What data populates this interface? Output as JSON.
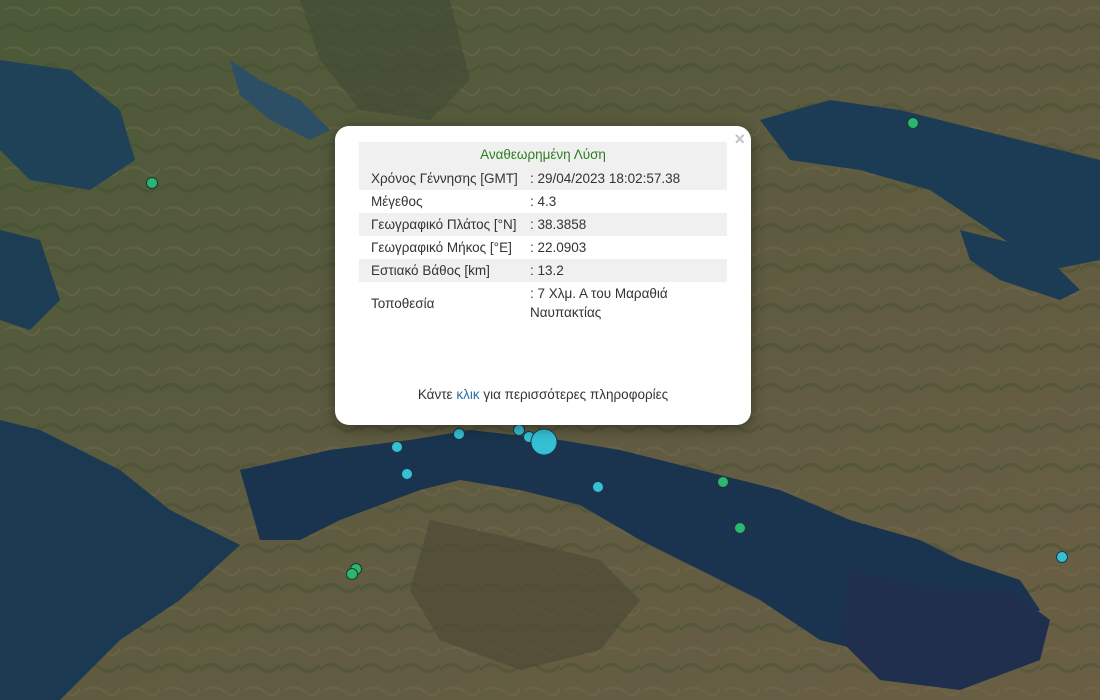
{
  "popup": {
    "header": "Αναθεωρημένη Λύση",
    "close_label": "×",
    "rows": [
      {
        "label": "Χρόνος Γέννησης [GMT]",
        "value": ": 29/04/2023 18:02:57.38"
      },
      {
        "label": "Μέγεθος",
        "value": ": 4.3"
      },
      {
        "label": "Γεωγραφικό Πλάτος [°N]",
        "value": ": 38.3858"
      },
      {
        "label": "Γεωγραφικό Μήκος [°E]",
        "value": ": 22.0903"
      },
      {
        "label": "Εστιακό Βάθος [km]",
        "value": ": 13.2"
      },
      {
        "label": "Τοποθεσία",
        "value": ": 7 Χλμ. Α του Μαραθιά Ναυπακτίας"
      }
    ],
    "footer_before": "Κάντε ",
    "footer_link": "κλικ",
    "footer_after": " για περισσότερες πληροφορίες"
  },
  "colors": {
    "green_marker": "#2bb673",
    "cyan_marker": "#35c0d6",
    "header_text": "#2e7d1f",
    "link": "#2b6fa8"
  },
  "map": {
    "base": "satellite imagery",
    "marker_count": 15,
    "highlighted_marker": "cyan-large"
  }
}
